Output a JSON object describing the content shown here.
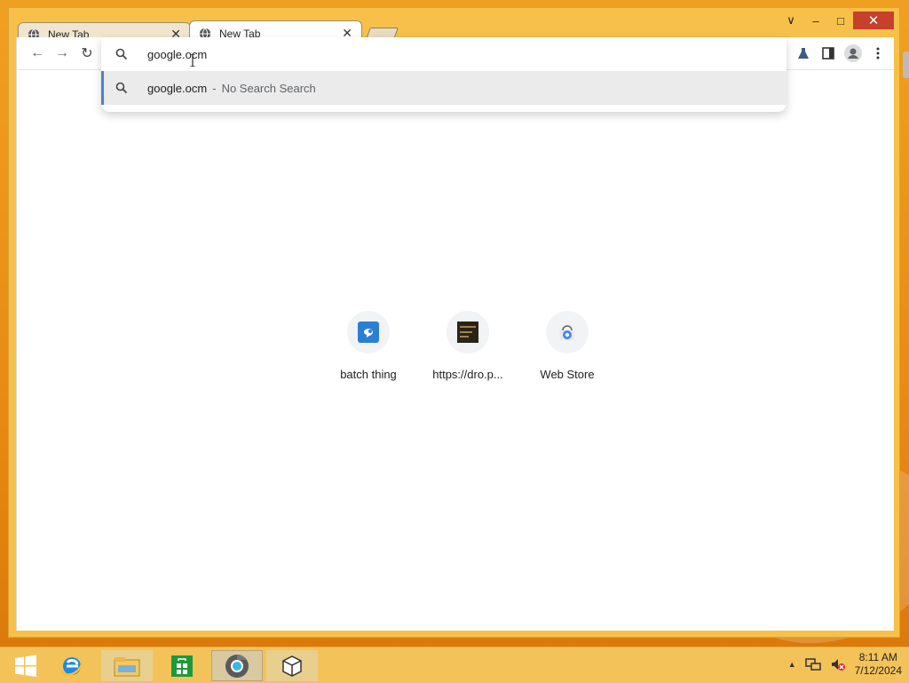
{
  "window": {
    "tabs": [
      {
        "label": "New Tab",
        "active": false
      },
      {
        "label": "New Tab",
        "active": true
      }
    ],
    "controls": {
      "dropdown": "∨",
      "minimize": "–",
      "maximize": "□",
      "close": "✕"
    }
  },
  "toolbar": {
    "back": "←",
    "forward": "→",
    "reload": "↻",
    "omnibox_value": "google.ocm"
  },
  "suggestion": {
    "main": "google.ocm",
    "separator": "-",
    "sub": "No Search Search"
  },
  "shortcuts": [
    {
      "label": "batch thing",
      "icon": "blue-chat-icon"
    },
    {
      "label": "https://dro.p...",
      "icon": "dark-thumbnail-icon"
    },
    {
      "label": "Web Store",
      "icon": "web-store-icon"
    }
  ],
  "taskbar": {
    "time": "8:11 AM",
    "date": "7/12/2024",
    "items": [
      "start-icon",
      "internet-explorer-icon",
      "file-explorer-icon",
      "store-icon",
      "chrome-icon",
      "package-icon"
    ]
  },
  "colors": {
    "accent": "#4a7fd9",
    "window_frame": "#f6c04a",
    "taskbar": "#f3c35a",
    "close_button": "#c7402b"
  }
}
